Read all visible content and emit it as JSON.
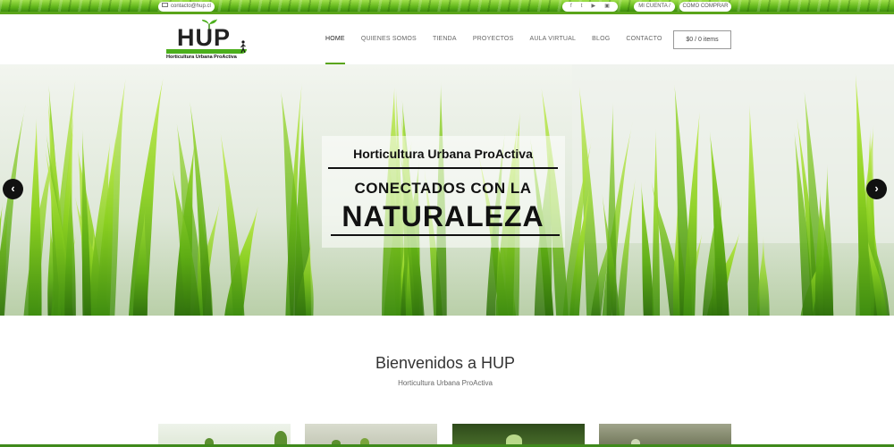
{
  "topbar": {
    "email": "contacto@hup.cl",
    "social_icons": [
      "facebook-icon",
      "twitter-icon",
      "youtube-icon",
      "instagram-icon"
    ],
    "social_glyphs": [
      "f",
      "t",
      "▶",
      "▣"
    ],
    "my_account": "MI CUENTA /",
    "how_to_buy": "COMO COMPRAR"
  },
  "logo": {
    "title": "HUP",
    "subtitle": "Horticultura Urbana ProActiva"
  },
  "nav": {
    "items": [
      {
        "label": "HOME",
        "active": true
      },
      {
        "label": "QUIENES SOMOS",
        "active": false
      },
      {
        "label": "TIENDA",
        "active": false
      },
      {
        "label": "PROYECTOS",
        "active": false
      },
      {
        "label": "AULA VIRTUAL",
        "active": false
      },
      {
        "label": "BLOG",
        "active": false
      },
      {
        "label": "CONTACTO",
        "active": false
      }
    ],
    "cart": "$0 / 0 items"
  },
  "hero": {
    "kicker": "Horticultura Urbana ProActiva",
    "title_line1": "CONECTADOS CON LA",
    "title_line2": "NATURALEZA",
    "prev_arrow": "‹",
    "next_arrow": "›"
  },
  "welcome": {
    "title": "Bienvenidos a HUP",
    "subtitle": "Horticultura Urbana ProActiva"
  },
  "colors": {
    "accent": "#5aa51a",
    "text": "#333333",
    "topbar": "#5fb51a"
  }
}
